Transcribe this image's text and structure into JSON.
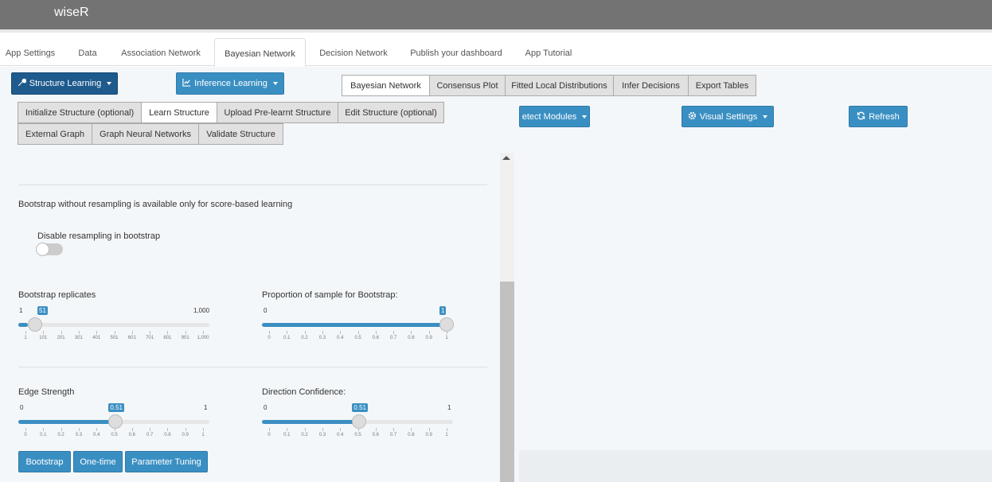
{
  "app": {
    "brand": "wiseR"
  },
  "nav_tabs": [
    {
      "label": "App Settings"
    },
    {
      "label": "Data"
    },
    {
      "label": "Association Network"
    },
    {
      "label": "Bayesian Network"
    },
    {
      "label": "Decision Network"
    },
    {
      "label": "Publish your dashboard"
    },
    {
      "label": "App Tutorial"
    }
  ],
  "dropdowns": {
    "structure_learning": "Structure Learning",
    "inference_learning": "Inference Learning"
  },
  "right_tabs": [
    {
      "label": "Bayesian Network"
    },
    {
      "label": "Consensus Plot"
    },
    {
      "label": "Fitted Local Distributions"
    },
    {
      "label": "Infer Decisions"
    },
    {
      "label": "Export Tables"
    }
  ],
  "sub_tabs_row1": [
    {
      "label": "Initialize Structure (optional)"
    },
    {
      "label": "Learn Structure"
    },
    {
      "label": "Upload Pre-learnt Structure"
    },
    {
      "label": "Edit Structure (optional)"
    }
  ],
  "sub_tabs_row2": [
    {
      "label": "External Graph"
    },
    {
      "label": "Graph Neural Networks"
    },
    {
      "label": "Validate Structure"
    }
  ],
  "right_buttons": {
    "detect_modules": "etect Modules",
    "visual_settings": "Visual Settings",
    "refresh": "Refresh"
  },
  "bootstrap_note": "Bootstrap without resampling is available only for score-based learning",
  "toggle": {
    "label": "Disable resampling in bootstrap",
    "on": false
  },
  "sliders": {
    "bootstrap_replicates": {
      "label": "Bootstrap replicates",
      "min_label": "1",
      "max_label": "1,000",
      "value_label": "51",
      "fraction": 0.05,
      "ticks": [
        "1",
        "101",
        "201",
        "301",
        "401",
        "501",
        "601",
        "701",
        "801",
        "901",
        "1,000"
      ]
    },
    "sample_proportion": {
      "label": "Proportion of sample for Bootstrap:",
      "min_label": "0",
      "value_label": "1",
      "fraction": 1.0,
      "ticks": [
        "0",
        "0.1",
        "0.2",
        "0.3",
        "0.4",
        "0.5",
        "0.6",
        "0.7",
        "0.8",
        "0.9",
        "1"
      ]
    },
    "edge_strength": {
      "label": "Edge Strength",
      "min_label": "0",
      "max_label": "1",
      "value_label": "0.51",
      "fraction": 0.51,
      "ticks": [
        "0",
        "0.1",
        "0.2",
        "0.3",
        "0.4",
        "0.5",
        "0.6",
        "0.7",
        "0.8",
        "0.9",
        "1"
      ]
    },
    "direction_confidence": {
      "label": "Direction Confidence:",
      "min_label": "0",
      "max_label": "1",
      "value_label": "0.51",
      "fraction": 0.51,
      "ticks": [
        "0",
        "0.1",
        "0.2",
        "0.3",
        "0.4",
        "0.5",
        "0.6",
        "0.7",
        "0.8",
        "0.9",
        "1"
      ]
    }
  },
  "bottom_buttons": {
    "bootstrap": "Bootstrap",
    "one_time": "One-time",
    "parameter_tuning": "Parameter Tuning"
  },
  "colors": {
    "header": "#737373",
    "primary_dark": "#1e5a8c",
    "primary": "#3a8fc2"
  }
}
